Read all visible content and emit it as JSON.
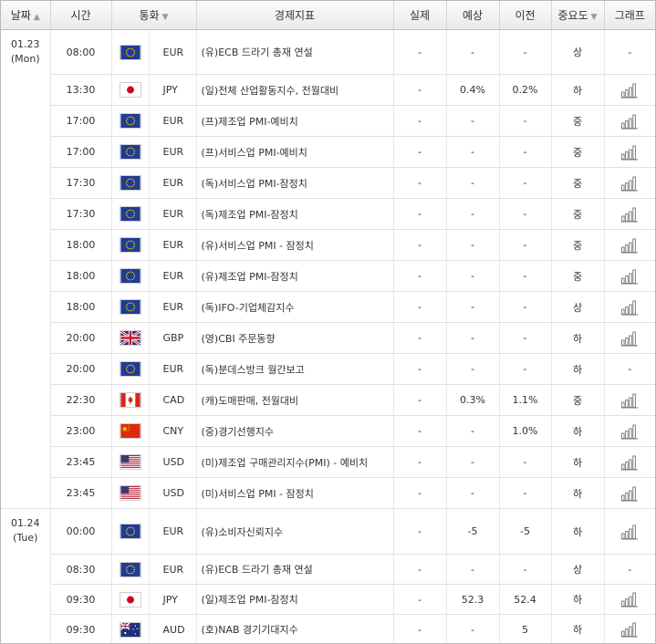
{
  "header": {
    "date": "날짜",
    "time": "시간",
    "currency": "통화",
    "event": "경제지표",
    "actual": "실제",
    "forecast": "예상",
    "previous": "이전",
    "importance": "중요도",
    "graph": "그래프"
  },
  "days": [
    {
      "date": "01.23",
      "weekday": "(Mon)",
      "rows": [
        {
          "time": "08:00",
          "flag": "eu-flag-icon",
          "currency": "EUR",
          "event": "(유)ECB 드라기 총재 연설",
          "actual": "-",
          "forecast": "-",
          "previous": "-",
          "importance": "상",
          "graph": "-"
        },
        {
          "time": "13:30",
          "flag": "jp-flag-icon",
          "currency": "JPY",
          "event": "(일)전체 산업활동지수, 전월대비",
          "actual": "-",
          "forecast": "0.4%",
          "previous": "0.2%",
          "importance": "하",
          "graph": "bar-chart-icon"
        },
        {
          "time": "17:00",
          "flag": "eu-flag-icon",
          "currency": "EUR",
          "event": "(프)제조업 PMI-예비치",
          "actual": "-",
          "forecast": "-",
          "previous": "-",
          "importance": "중",
          "graph": "bar-chart-icon"
        },
        {
          "time": "17:00",
          "flag": "eu-flag-icon",
          "currency": "EUR",
          "event": "(프)서비스업 PMI-예비치",
          "actual": "-",
          "forecast": "-",
          "previous": "-",
          "importance": "중",
          "graph": "bar-chart-icon"
        },
        {
          "time": "17:30",
          "flag": "eu-flag-icon",
          "currency": "EUR",
          "event": "(독)서비스업 PMI-잠정치",
          "actual": "-",
          "forecast": "-",
          "previous": "-",
          "importance": "중",
          "graph": "bar-chart-icon"
        },
        {
          "time": "17:30",
          "flag": "eu-flag-icon",
          "currency": "EUR",
          "event": "(독)제조업 PMI-잠정치",
          "actual": "-",
          "forecast": "-",
          "previous": "-",
          "importance": "중",
          "graph": "bar-chart-icon"
        },
        {
          "time": "18:00",
          "flag": "eu-flag-icon",
          "currency": "EUR",
          "event": "(유)서비스업 PMI - 잠정치",
          "actual": "-",
          "forecast": "-",
          "previous": "-",
          "importance": "중",
          "graph": "bar-chart-icon"
        },
        {
          "time": "18:00",
          "flag": "eu-flag-icon",
          "currency": "EUR",
          "event": "(유)제조업 PMI-잠정치",
          "actual": "-",
          "forecast": "-",
          "previous": "-",
          "importance": "중",
          "graph": "bar-chart-icon"
        },
        {
          "time": "18:00",
          "flag": "eu-flag-icon",
          "currency": "EUR",
          "event": "(독)IFO-기업체감지수",
          "actual": "-",
          "forecast": "-",
          "previous": "-",
          "importance": "상",
          "graph": "bar-chart-icon"
        },
        {
          "time": "20:00",
          "flag": "gb-flag-icon",
          "currency": "GBP",
          "event": "(영)CBI 주문동향",
          "actual": "-",
          "forecast": "-",
          "previous": "-",
          "importance": "하",
          "graph": "bar-chart-icon"
        },
        {
          "time": "20:00",
          "flag": "eu-flag-icon",
          "currency": "EUR",
          "event": "(독)분데스방크 월간보고",
          "actual": "-",
          "forecast": "-",
          "previous": "-",
          "importance": "하",
          "graph": "-"
        },
        {
          "time": "22:30",
          "flag": "ca-flag-icon",
          "currency": "CAD",
          "event": "(캐)도매판매, 전월대비",
          "actual": "-",
          "forecast": "0.3%",
          "previous": "1.1%",
          "importance": "중",
          "graph": "bar-chart-icon"
        },
        {
          "time": "23:00",
          "flag": "cn-flag-icon",
          "currency": "CNY",
          "event": "(중)경기선행지수",
          "actual": "-",
          "forecast": "-",
          "previous": "1.0%",
          "importance": "하",
          "graph": "bar-chart-icon"
        },
        {
          "time": "23:45",
          "flag": "us-flag-icon",
          "currency": "USD",
          "event": "(미)제조업 구매관리지수(PMI) - 예비치",
          "actual": "-",
          "forecast": "-",
          "previous": "-",
          "importance": "하",
          "graph": "bar-chart-icon"
        },
        {
          "time": "23:45",
          "flag": "us-flag-icon",
          "currency": "USD",
          "event": "(미)서비스업 PMI - 잠정치",
          "actual": "-",
          "forecast": "-",
          "previous": "-",
          "importance": "하",
          "graph": "bar-chart-icon"
        }
      ]
    },
    {
      "date": "01.24",
      "weekday": "(Tue)",
      "rows": [
        {
          "time": "00:00",
          "flag": "eu-flag-icon",
          "currency": "EUR",
          "event": "(유)소비자신뢰지수",
          "actual": "-",
          "forecast": "-5",
          "previous": "-5",
          "importance": "하",
          "graph": "bar-chart-icon"
        },
        {
          "time": "08:30",
          "flag": "eu-flag-icon",
          "currency": "EUR",
          "event": "(유)ECB 드라기 총재 연설",
          "actual": "-",
          "forecast": "-",
          "previous": "-",
          "importance": "상",
          "graph": "-"
        },
        {
          "time": "09:30",
          "flag": "jp-flag-icon",
          "currency": "JPY",
          "event": "(일)제조업 PMI-잠정치",
          "actual": "-",
          "forecast": "52.3",
          "previous": "52.4",
          "importance": "하",
          "graph": "bar-chart-icon"
        },
        {
          "time": "09:30",
          "flag": "au-flag-icon",
          "currency": "AUD",
          "event": "(호)NAB 경기기대지수",
          "actual": "-",
          "forecast": "-",
          "previous": "5",
          "importance": "하",
          "graph": "bar-chart-icon"
        }
      ]
    }
  ]
}
